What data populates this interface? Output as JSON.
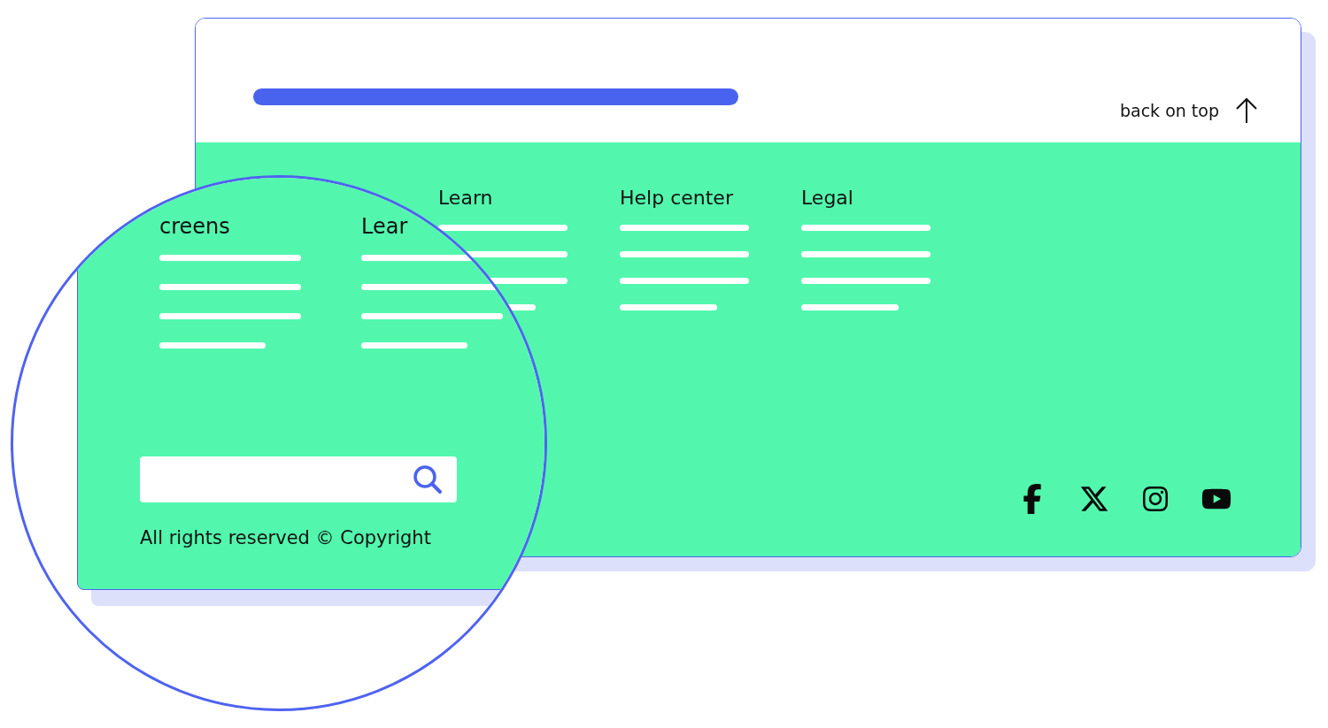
{
  "header": {
    "back_to_top": "back on top"
  },
  "footer": {
    "columns": [
      {
        "heading": "Learn"
      },
      {
        "heading": "Help center"
      },
      {
        "heading": "Legal"
      }
    ]
  },
  "magnifier": {
    "columns": [
      {
        "heading": "creens"
      },
      {
        "heading": "Lear"
      }
    ],
    "copyright": "All rights reserved © Copyright"
  }
}
